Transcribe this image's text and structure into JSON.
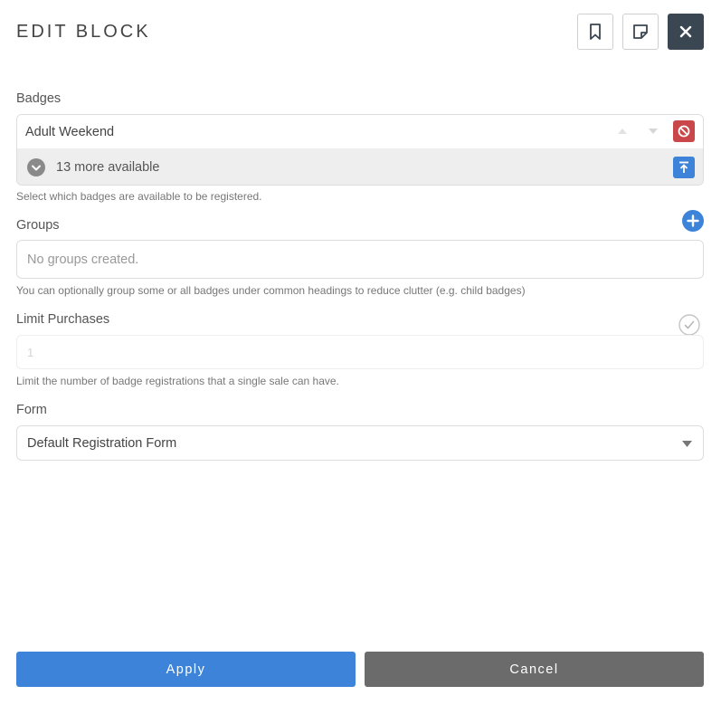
{
  "header": {
    "title": "EDIT BLOCK",
    "bookmark_icon": "bookmark-icon",
    "note_icon": "sticky-note-icon",
    "close_icon": "close-icon"
  },
  "badges": {
    "label": "Badges",
    "selected": [
      {
        "name": "Adult Weekend"
      }
    ],
    "more_available": "13 more available",
    "help": "Select which badges are available to be registered."
  },
  "groups": {
    "label": "Groups",
    "placeholder": "No groups created.",
    "help": "You can optionally group some or all badges under common headings to reduce clutter (e.g. child badges)"
  },
  "limit": {
    "label": "Limit Purchases",
    "value": "1",
    "help": "Limit the number of badge registrations that a single sale can have."
  },
  "form": {
    "label": "Form",
    "selected": "Default Registration Form"
  },
  "footer": {
    "apply_label": "Apply",
    "cancel_label": "Cancel"
  },
  "colors": {
    "primary": "#3c83d9",
    "danger": "#c9474a",
    "dark": "#3a4652",
    "secondary": "#6b6b6b"
  }
}
